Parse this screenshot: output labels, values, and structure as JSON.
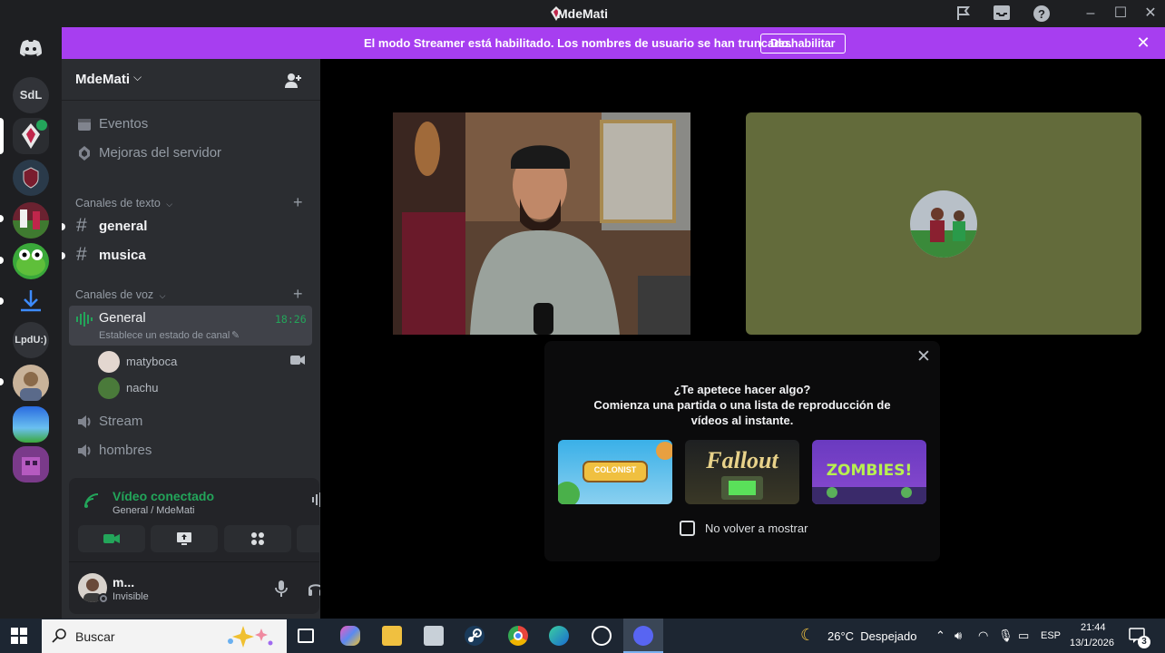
{
  "window": {
    "title": "MdeMati"
  },
  "rail": {
    "servers": [
      "SdL",
      "LpdU:)"
    ]
  },
  "banner": {
    "text": "El modo Streamer está habilitado. Los nombres de usuario se han truncado.",
    "button": "Deshabilitar"
  },
  "sidebar": {
    "guild": "MdeMati",
    "top_items": [
      {
        "label": "Eventos"
      },
      {
        "label": "Mejoras del servidor"
      }
    ],
    "text_category": "Canales de texto",
    "text_channels": [
      {
        "label": "general"
      },
      {
        "label": "musica"
      }
    ],
    "voice_category": "Canales de voz",
    "active_voice": {
      "label": "General",
      "time": "18:26",
      "status": "Establece un estado de canal"
    },
    "members": [
      {
        "name": "matyboca"
      },
      {
        "name": "nachu"
      }
    ],
    "voice_channels": [
      {
        "label": "Stream"
      },
      {
        "label": "hombres"
      }
    ]
  },
  "voice_panel": {
    "status": "Vídeo conectado",
    "location": "General / MdeMati"
  },
  "user_panel": {
    "name": "m...",
    "status": "Invisible"
  },
  "activity": {
    "title": "¿Te apetece hacer algo?",
    "subtitle": "Comienza una partida o una lista de reproducción de vídeos al instante.",
    "games": [
      {
        "label": "COLONIST"
      },
      {
        "label": "Fallout"
      },
      {
        "label": "ZOMBIES!"
      }
    ],
    "checkbox_label": "No volver a mostrar"
  },
  "taskbar": {
    "search_placeholder": "Buscar",
    "weather": "26°C  Despejado",
    "language": "ESP",
    "time": "21:44",
    "date": "13/1/2026",
    "notifications": "3"
  },
  "colors": {
    "brand": "#5865f2",
    "banner": "#a73ef0",
    "connected": "#23a55a",
    "sidebar": "#2b2d31"
  }
}
